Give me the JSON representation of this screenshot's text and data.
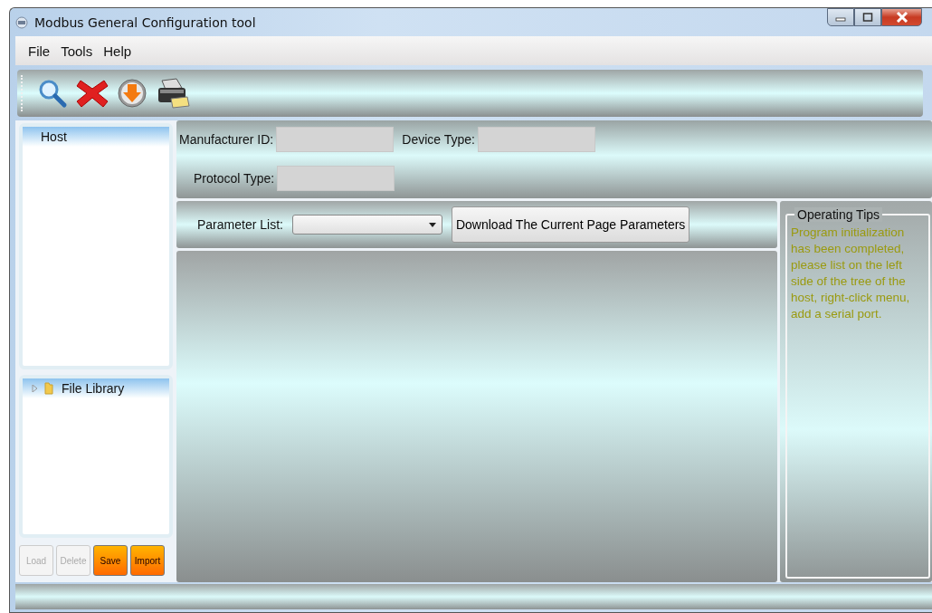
{
  "window": {
    "title": "Modbus General Configuration tool"
  },
  "menu": [
    "File",
    "Tools",
    "Help"
  ],
  "host_tree": {
    "items": [
      {
        "label": "Host",
        "selected": true
      }
    ]
  },
  "library_tree": {
    "items": [
      {
        "label": "File Library",
        "selected": true,
        "expanded": false
      }
    ]
  },
  "library_buttons": [
    {
      "label": "Load",
      "disabled": true
    },
    {
      "label": "Delete",
      "disabled": true
    },
    {
      "label": "Save",
      "disabled": false
    },
    {
      "label": "Import",
      "disabled": false
    }
  ],
  "device_rows": [
    {
      "fields": [
        {
          "label": "Manufacturer ID:"
        },
        {
          "label": "Device Type:"
        }
      ]
    },
    {
      "fields": [
        {
          "label": "Protocol Type:"
        }
      ]
    }
  ],
  "parameter_list": {
    "label": "Parameter List:"
  },
  "download_button": "Download The Current Page Parameters",
  "operating_tips": {
    "title": "Operating Tips",
    "text": "Program initialization has been completed, please list on the left side of the tree of the host, right-click menu, add a serial port."
  }
}
